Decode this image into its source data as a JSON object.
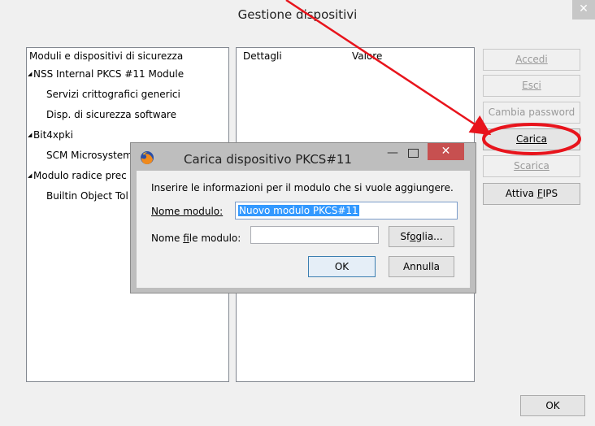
{
  "window": {
    "title": "Gestione dispositivi",
    "close_glyph": "✕"
  },
  "tree": {
    "header": "Moduli e dispositivi di sicurezza",
    "items": [
      {
        "label": "NSS Internal PKCS #11 Module",
        "level": 0
      },
      {
        "label": "Servizi crittografici generici",
        "level": 1
      },
      {
        "label": "Disp. di sicurezza software",
        "level": 1
      },
      {
        "label": "Bit4xpki",
        "level": 0
      },
      {
        "label": "SCM Microsystem",
        "level": 1
      },
      {
        "label": "Modulo radice prec",
        "level": 0
      },
      {
        "label": "Builtin Object Tol",
        "level": 1
      }
    ]
  },
  "details": {
    "col_details": "Dettagli",
    "col_value": "Valore"
  },
  "side_buttons": {
    "login": "Accedi",
    "logout": "Esci",
    "change_password": "Cambia password",
    "load": "Carica",
    "unload": "Scarica",
    "fips_prefix": "Attiva ",
    "fips_ul": "F",
    "fips_rest": "IPS"
  },
  "ok_label": "OK",
  "dialog": {
    "title": "Carica dispositivo PKCS#11",
    "info": "Inserire le informazioni per il modulo che si vuole aggiungere.",
    "name_label": "Nome modulo:",
    "name_value": "Nuovo modulo PKCS#11",
    "file_label_prefix": "Nome ",
    "file_label_ul": "f",
    "file_label_rest": "ile modulo:",
    "file_value": "",
    "browse_prefix": "Sf",
    "browse_ul": "o",
    "browse_rest": "glia...",
    "ok": "OK",
    "cancel": "Annulla",
    "minimize_glyph": "—",
    "close_glyph": "✕"
  },
  "colors": {
    "annotation": "#e8141c",
    "dialog_close": "#c75050"
  },
  "icons": {
    "tree_expanded": "expanded-triangle-icon",
    "dialog_app": "firefox-icon"
  }
}
